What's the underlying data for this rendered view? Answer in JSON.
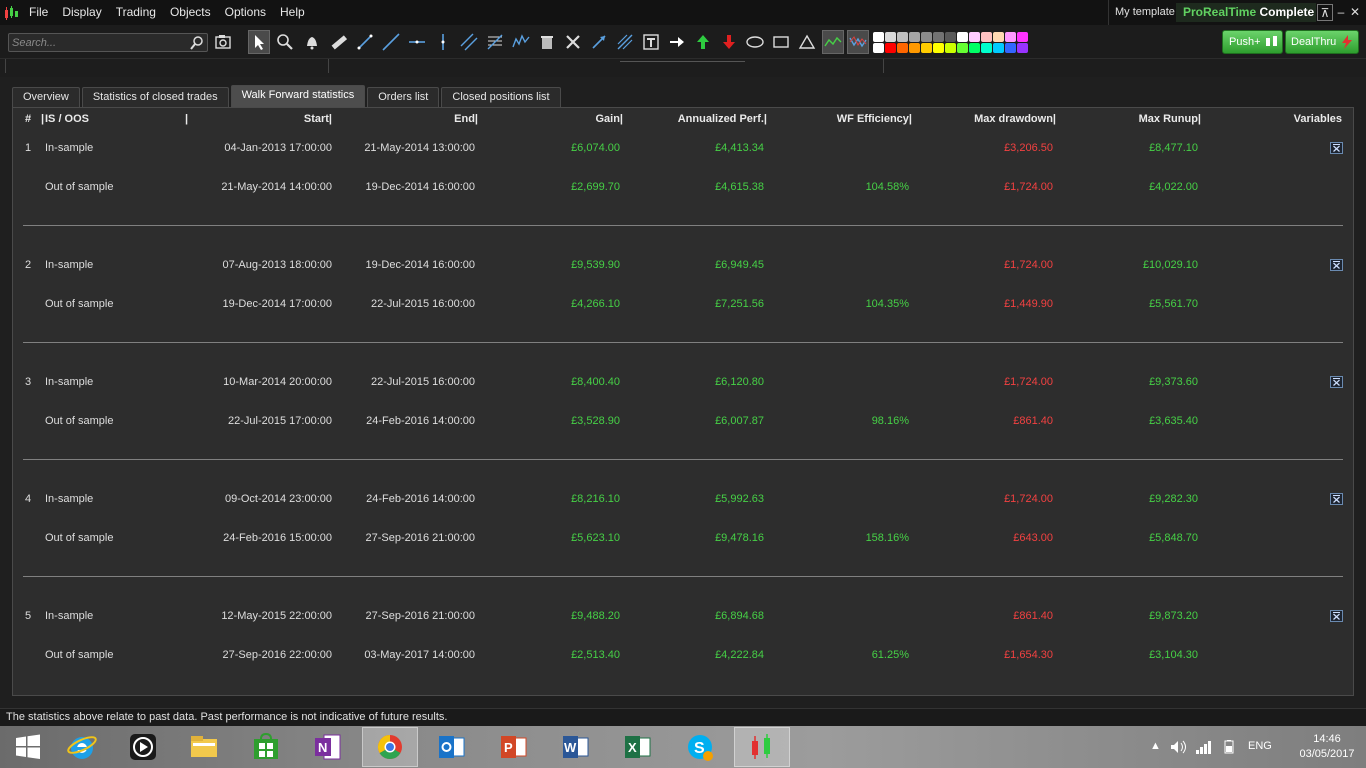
{
  "menu": [
    "File",
    "Display",
    "Trading",
    "Objects",
    "Options",
    "Help"
  ],
  "template_label": "My template",
  "product_name_brand": "ProRealTime",
  "product_name_edition": "Complete",
  "window_controls": {
    "pin": "⊼",
    "minimize": "–",
    "close": "✕"
  },
  "search": {
    "placeholder": "Search..."
  },
  "buttons": {
    "push": "Push+",
    "dealthru": "DealThru"
  },
  "colors": {
    "gain_green": "#46d046",
    "loss_red": "#f24141",
    "panel_bg": "#2d2d2d",
    "push_green": "#2e9e2e"
  },
  "palette": [
    "#ffffff",
    "#d9d9d9",
    "#bfbfbf",
    "#a6a6a6",
    "#8c8c8c",
    "#737373",
    "#595959",
    "#ffffff",
    "#ffccff",
    "#ffc2c2",
    "#ffd9b3",
    "#ff99ff",
    "#ff33ff",
    "#ffffff",
    "#ff0000",
    "#ff6600",
    "#ff9900",
    "#ffcc00",
    "#ffff00",
    "#ccff00",
    "#66ff33",
    "#00ff66",
    "#00ffcc",
    "#00ccff",
    "#3366ff",
    "#9933ff"
  ],
  "tabs": [
    "Overview",
    "Statistics of closed trades",
    "Walk Forward statistics",
    "Orders list",
    "Closed positions list"
  ],
  "active_tab": "Walk Forward statistics",
  "table": {
    "headers": {
      "num": "#",
      "is_oos": "IS / OOS",
      "start": "Start",
      "end": "End",
      "gain": "Gain",
      "annualized": "Annualized Perf.",
      "wf_efficiency": "WF Efficiency",
      "max_drawdown": "Max drawdown",
      "max_runup": "Max Runup",
      "variables": "Variables"
    },
    "groups": [
      {
        "num": "1",
        "is": {
          "label": "In-sample",
          "start": "04-Jan-2013 17:00:00",
          "end": "21-May-2014 13:00:00",
          "gain": "£6,074.00",
          "annualized": "£4,413.34",
          "wfe": "",
          "dd": "£3,206.50",
          "runup": "£8,477.10"
        },
        "oos": {
          "label": "Out of sample",
          "start": "21-May-2014 14:00:00",
          "end": "19-Dec-2014 16:00:00",
          "gain": "£2,699.70",
          "annualized": "£4,615.38",
          "wfe": "104.58%",
          "dd": "£1,724.00",
          "runup": "£4,022.00"
        }
      },
      {
        "num": "2",
        "is": {
          "label": "In-sample",
          "start": "07-Aug-2013 18:00:00",
          "end": "19-Dec-2014 16:00:00",
          "gain": "£9,539.90",
          "annualized": "£6,949.45",
          "wfe": "",
          "dd": "£1,724.00",
          "runup": "£10,029.10"
        },
        "oos": {
          "label": "Out of sample",
          "start": "19-Dec-2014 17:00:00",
          "end": "22-Jul-2015 16:00:00",
          "gain": "£4,266.10",
          "annualized": "£7,251.56",
          "wfe": "104.35%",
          "dd": "£1,449.90",
          "runup": "£5,561.70"
        }
      },
      {
        "num": "3",
        "is": {
          "label": "In-sample",
          "start": "10-Mar-2014 20:00:00",
          "end": "22-Jul-2015 16:00:00",
          "gain": "£8,400.40",
          "annualized": "£6,120.80",
          "wfe": "",
          "dd": "£1,724.00",
          "runup": "£9,373.60"
        },
        "oos": {
          "label": "Out of sample",
          "start": "22-Jul-2015 17:00:00",
          "end": "24-Feb-2016 14:00:00",
          "gain": "£3,528.90",
          "annualized": "£6,007.87",
          "wfe": "98.16%",
          "dd": "£861.40",
          "runup": "£3,635.40"
        }
      },
      {
        "num": "4",
        "is": {
          "label": "In-sample",
          "start": "09-Oct-2014 23:00:00",
          "end": "24-Feb-2016 14:00:00",
          "gain": "£8,216.10",
          "annualized": "£5,992.63",
          "wfe": "",
          "dd": "£1,724.00",
          "runup": "£9,282.30"
        },
        "oos": {
          "label": "Out of sample",
          "start": "24-Feb-2016 15:00:00",
          "end": "27-Sep-2016 21:00:00",
          "gain": "£5,623.10",
          "annualized": "£9,478.16",
          "wfe": "158.16%",
          "dd": "£643.00",
          "runup": "£5,848.70"
        }
      },
      {
        "num": "5",
        "is": {
          "label": "In-sample",
          "start": "12-May-2015 22:00:00",
          "end": "27-Sep-2016 21:00:00",
          "gain": "£9,488.20",
          "annualized": "£6,894.68",
          "wfe": "",
          "dd": "£861.40",
          "runup": "£9,873.20"
        },
        "oos": {
          "label": "Out of sample",
          "start": "27-Sep-2016 22:00:00",
          "end": "03-May-2017 14:00:00",
          "gain": "£2,513.40",
          "annualized": "£4,222.84",
          "wfe": "61.25%",
          "dd": "£1,654.30",
          "runup": "£3,104.30"
        }
      }
    ]
  },
  "status_text": "The statistics above relate to past data. Past performance is not indicative of future results.",
  "taskbar": {
    "apps": [
      "start-icon",
      "internet-explorer-icon",
      "media-player-icon",
      "file-explorer-icon",
      "store-icon",
      "onenote-icon",
      "chrome-icon",
      "outlook-icon",
      "powerpoint-icon",
      "word-icon",
      "excel-icon",
      "skype-icon",
      "prorealtime-icon"
    ],
    "language": "ENG",
    "time": "14:46",
    "date": "03/05/2017"
  }
}
